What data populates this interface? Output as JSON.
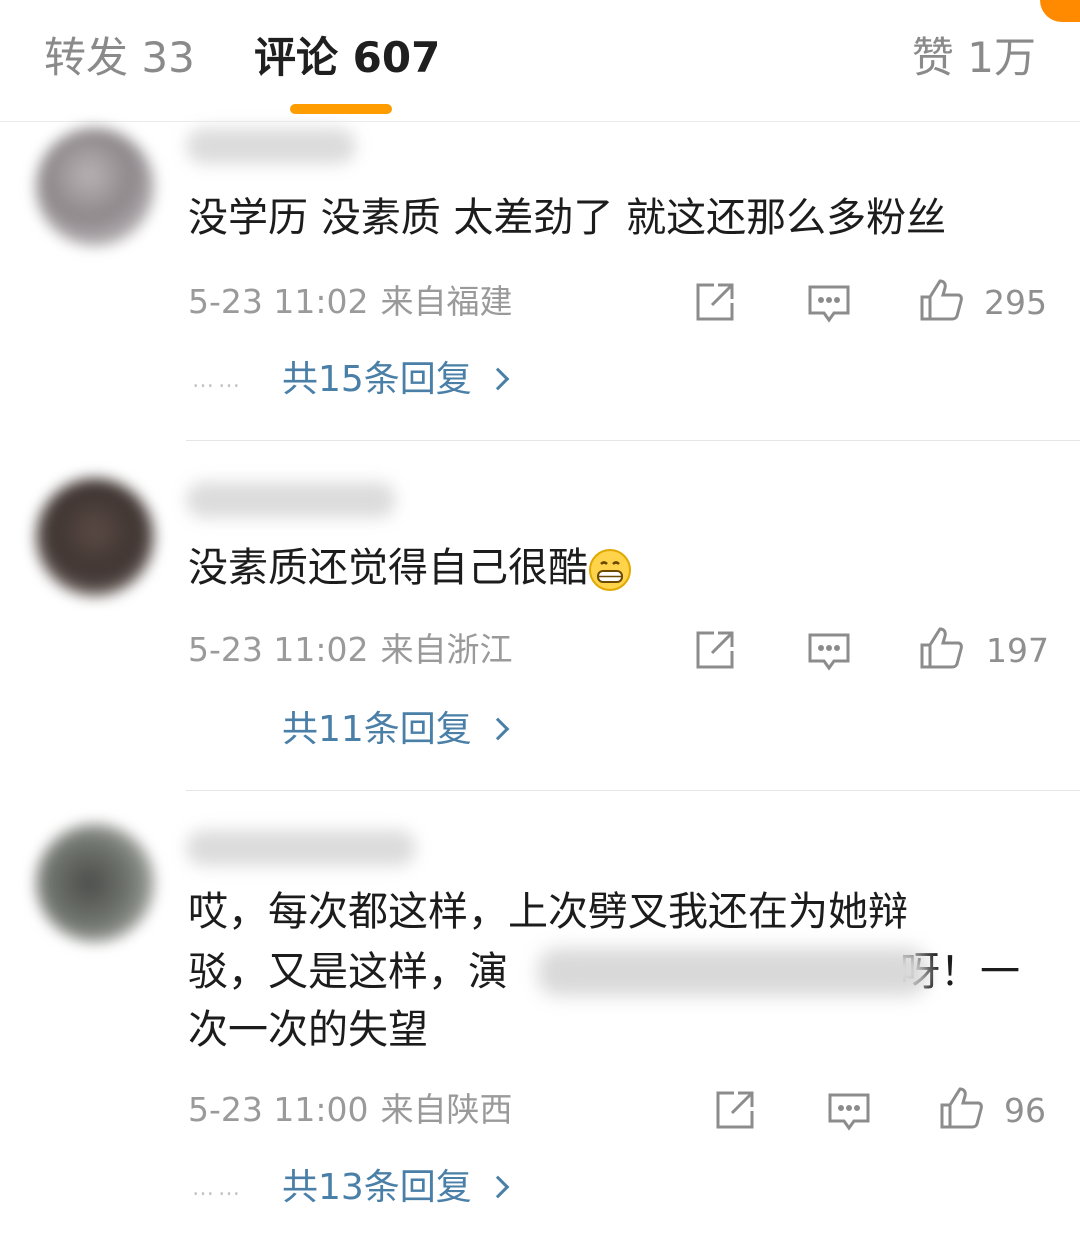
{
  "tabs": {
    "repost": "转发 33",
    "comment": "评论 607",
    "likes": "赞 1万"
  },
  "colors": {
    "accent": "#ff9c00",
    "link": "#4a7fa8"
  },
  "comments": [
    {
      "text_line1": "没学历 没素质 太差劲了 就这还那么多粉丝",
      "time": "5-23 11:02",
      "location": "来自福建",
      "likes": "295",
      "replies_label": "共15条回复",
      "dots": "……"
    },
    {
      "text_line1": "没素质还觉得自己很酷",
      "emoji_icon": "grinning-face-icon",
      "time": "5-23 11:02",
      "location": "来自浙江",
      "likes": "197",
      "replies_label": "共11条回复"
    },
    {
      "text_line1": "哎，每次都这样，上次劈叉我还在为她辩",
      "text_line2_start": "驳，又是这样，演",
      "text_line2_end": "呀！一",
      "text_line3": "次一次的失望",
      "time": "5-23 11:00",
      "location": "来自陕西",
      "likes": "96",
      "replies_label": "共13条回复",
      "dots": "……"
    }
  ],
  "icons": [
    "share-icon",
    "comment-icon",
    "like-icon",
    "chevron-right-icon"
  ]
}
